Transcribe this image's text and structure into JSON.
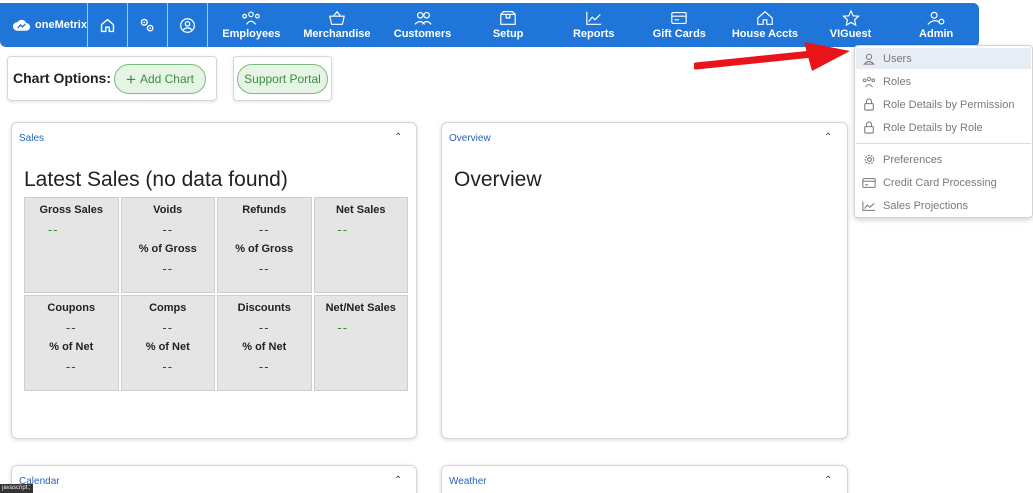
{
  "app": {
    "logo_text": "oneMetrix"
  },
  "nav": {
    "items": [
      {
        "label": "Employees",
        "icon": "employees-icon"
      },
      {
        "label": "Merchandise",
        "icon": "basket-icon"
      },
      {
        "label": "Customers",
        "icon": "customers-icon"
      },
      {
        "label": "Setup",
        "icon": "setup-box-icon"
      },
      {
        "label": "Reports",
        "icon": "chart-line-icon"
      },
      {
        "label": "Gift Cards",
        "icon": "card-icon"
      },
      {
        "label": "House Accts",
        "icon": "house-icon"
      },
      {
        "label": "VIGuest",
        "icon": "star-icon"
      },
      {
        "label": "Admin",
        "icon": "admin-user-icon"
      }
    ]
  },
  "chart_options": {
    "label": "Chart Options:",
    "add_chart": "Add Chart"
  },
  "support": {
    "label": "Support Portal"
  },
  "sales_panel": {
    "title": "Sales",
    "heading": "Latest Sales (no data found)",
    "cells": [
      {
        "header": "Gross Sales",
        "value": "--",
        "sub": "",
        "sub_value": "",
        "green": true
      },
      {
        "header": "Voids",
        "value": "--",
        "sub": "% of Gross",
        "sub_value": "--",
        "green": false
      },
      {
        "header": "Refunds",
        "value": "--",
        "sub": "% of Gross",
        "sub_value": "--",
        "green": false
      },
      {
        "header": "Net Sales",
        "value": "--",
        "sub": "",
        "sub_value": "",
        "green": true
      },
      {
        "header": "Coupons",
        "value": "--",
        "sub": "% of Net",
        "sub_value": "--",
        "green": false
      },
      {
        "header": "Comps",
        "value": "--",
        "sub": "% of Net",
        "sub_value": "--",
        "green": false
      },
      {
        "header": "Discounts",
        "value": "--",
        "sub": "% of Net",
        "sub_value": "--",
        "green": false
      },
      {
        "header": "Net/Net Sales",
        "value": "--",
        "sub": "",
        "sub_value": "",
        "green": true
      }
    ]
  },
  "overview_panel": {
    "title": "Overview",
    "heading": "Overview"
  },
  "calendar_panel": {
    "title": "Calendar"
  },
  "weather_panel": {
    "title": "Weather"
  },
  "admin_menu": {
    "items": [
      {
        "label": "Users",
        "icon": "user-icon"
      },
      {
        "label": "Roles",
        "icon": "roles-icon"
      },
      {
        "label": "Role Details by Permission",
        "icon": "lock-icon"
      },
      {
        "label": "Role Details by Role",
        "icon": "lock-icon"
      },
      {
        "label": "Preferences",
        "icon": "gear-icon"
      },
      {
        "label": "Credit Card Processing",
        "icon": "credit-card-icon"
      },
      {
        "label": "Sales Projections",
        "icon": "chart-line-icon"
      }
    ]
  },
  "status_bar": {
    "text": "javascript:;"
  },
  "colors": {
    "nav_bg": "#1f76d8",
    "accent_green": "#2f8f2f",
    "arrow_red": "#e8141a",
    "panel_title": "#2a62b8"
  }
}
